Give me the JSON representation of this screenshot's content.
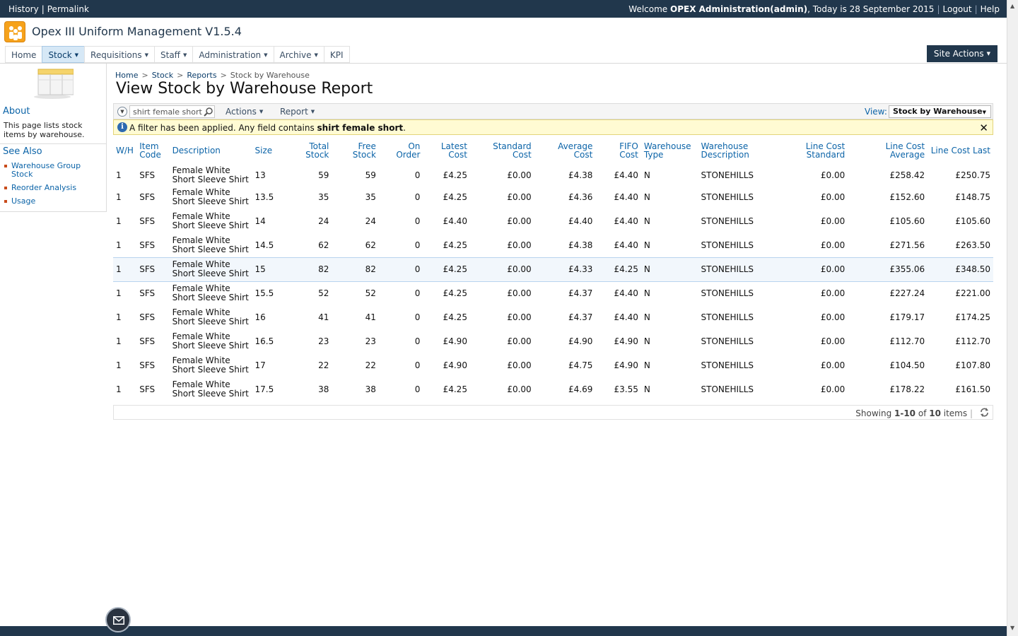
{
  "topbar": {
    "history": "History",
    "permalink": "Permalink",
    "welcome_prefix": "Welcome ",
    "user": "OPEX Administration(admin)",
    "today": ", Today is 28 September 2015",
    "logout": "Logout",
    "help": "Help"
  },
  "app": {
    "title": "Opex III Uniform Management V1.5.4"
  },
  "nav": {
    "home": "Home",
    "stock": "Stock",
    "requisitions": "Requisitions",
    "staff": "Staff",
    "administration": "Administration",
    "archive": "Archive",
    "kpi": "KPI",
    "site_actions": "Site Actions"
  },
  "left": {
    "about_title": "About",
    "about_text": "This page lists stock items by warehouse.",
    "see_also_title": "See Also",
    "links": [
      "Warehouse Group Stock",
      "Reorder Analysis",
      "Usage"
    ]
  },
  "breadcrumb": {
    "home": "Home",
    "stock": "Stock",
    "reports": "Reports",
    "current": "Stock by Warehouse"
  },
  "page": {
    "title": "View Stock by Warehouse Report"
  },
  "toolbar": {
    "search_value": "shirt female short",
    "actions": "Actions",
    "report": "Report",
    "view_label": "View:",
    "view_value": "Stock by Warehouse"
  },
  "filter": {
    "prefix": "A filter has been applied. Any field contains ",
    "term": "shirt female short",
    "suffix": "."
  },
  "table": {
    "headers": [
      "W/H",
      "Item Code",
      "Description",
      "Size",
      "Total Stock",
      "Free Stock",
      "On Order",
      "Latest Cost",
      "Standard Cost",
      "Average Cost",
      "FIFO Cost",
      "Warehouse Type",
      "Warehouse Description",
      "Line Cost Standard",
      "Line Cost Average",
      "Line Cost Last"
    ],
    "rows": [
      [
        "1",
        "SFS",
        "Female White Short Sleeve Shirt",
        "13",
        "59",
        "59",
        "0",
        "£4.25",
        "£0.00",
        "£4.38",
        "£4.40",
        "N",
        "STONEHILLS",
        "£0.00",
        "£258.42",
        "£250.75"
      ],
      [
        "1",
        "SFS",
        "Female White Short Sleeve Shirt",
        "13.5",
        "35",
        "35",
        "0",
        "£4.25",
        "£0.00",
        "£4.36",
        "£4.40",
        "N",
        "STONEHILLS",
        "£0.00",
        "£152.60",
        "£148.75"
      ],
      [
        "1",
        "SFS",
        "Female White Short Sleeve Shirt",
        "14",
        "24",
        "24",
        "0",
        "£4.40",
        "£0.00",
        "£4.40",
        "£4.40",
        "N",
        "STONEHILLS",
        "£0.00",
        "£105.60",
        "£105.60"
      ],
      [
        "1",
        "SFS",
        "Female White Short Sleeve Shirt",
        "14.5",
        "62",
        "62",
        "0",
        "£4.25",
        "£0.00",
        "£4.38",
        "£4.40",
        "N",
        "STONEHILLS",
        "£0.00",
        "£271.56",
        "£263.50"
      ],
      [
        "1",
        "SFS",
        "Female White Short Sleeve Shirt",
        "15",
        "82",
        "82",
        "0",
        "£4.25",
        "£0.00",
        "£4.33",
        "£4.25",
        "N",
        "STONEHILLS",
        "£0.00",
        "£355.06",
        "£348.50"
      ],
      [
        "1",
        "SFS",
        "Female White Short Sleeve Shirt",
        "15.5",
        "52",
        "52",
        "0",
        "£4.25",
        "£0.00",
        "£4.37",
        "£4.40",
        "N",
        "STONEHILLS",
        "£0.00",
        "£227.24",
        "£221.00"
      ],
      [
        "1",
        "SFS",
        "Female White Short Sleeve Shirt",
        "16",
        "41",
        "41",
        "0",
        "£4.25",
        "£0.00",
        "£4.37",
        "£4.40",
        "N",
        "STONEHILLS",
        "£0.00",
        "£179.17",
        "£174.25"
      ],
      [
        "1",
        "SFS",
        "Female White Short Sleeve Shirt",
        "16.5",
        "23",
        "23",
        "0",
        "£4.90",
        "£0.00",
        "£4.90",
        "£4.90",
        "N",
        "STONEHILLS",
        "£0.00",
        "£112.70",
        "£112.70"
      ],
      [
        "1",
        "SFS",
        "Female White Short Sleeve Shirt",
        "17",
        "22",
        "22",
        "0",
        "£4.90",
        "£0.00",
        "£4.75",
        "£4.90",
        "N",
        "STONEHILLS",
        "£0.00",
        "£104.50",
        "£107.80"
      ],
      [
        "1",
        "SFS",
        "Female White Short Sleeve Shirt",
        "17.5",
        "38",
        "38",
        "0",
        "£4.25",
        "£0.00",
        "£4.69",
        "£3.55",
        "N",
        "STONEHILLS",
        "£0.00",
        "£178.22",
        "£161.50"
      ]
    ],
    "selected_row": 4
  },
  "paging": {
    "prefix": "Showing ",
    "range": "1-10",
    "of": " of ",
    "total": "10",
    "suffix": " items"
  },
  "colors": {
    "header_bg": "#21374c",
    "link": "#0c64a8",
    "filter_bg": "#fffbd3",
    "logo": "#f6a21b"
  }
}
